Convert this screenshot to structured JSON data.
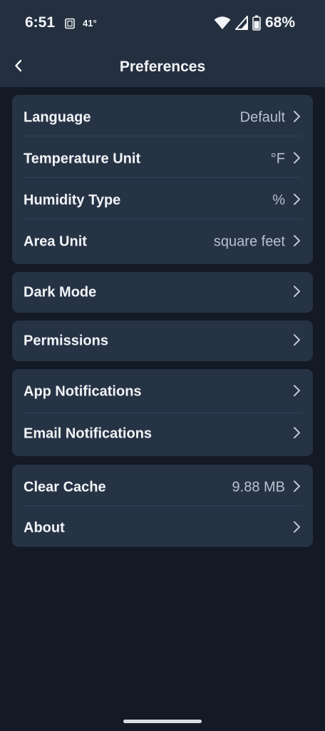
{
  "status_bar": {
    "time": "6:51",
    "temperature": "41°",
    "battery": "68%",
    "icons": [
      "sim-card-icon",
      "wifi-icon",
      "signal-icon",
      "battery-icon"
    ]
  },
  "header": {
    "title": "Preferences",
    "back_icon": "chevron-left-icon"
  },
  "sections": {
    "units": {
      "language": {
        "label": "Language",
        "value": "Default"
      },
      "temperature_unit": {
        "label": "Temperature Unit",
        "value": "°F"
      },
      "humidity_type": {
        "label": "Humidity Type",
        "value": "%"
      },
      "area_unit": {
        "label": "Area Unit",
        "value": "square feet"
      }
    },
    "appearance": {
      "dark_mode": {
        "label": "Dark Mode"
      }
    },
    "access": {
      "permissions": {
        "label": "Permissions"
      }
    },
    "notifications": {
      "app": {
        "label": "App Notifications"
      },
      "email": {
        "label": "Email Notifications"
      }
    },
    "misc": {
      "clear_cache": {
        "label": "Clear Cache",
        "value": "9.88 MB"
      },
      "about": {
        "label": "About"
      }
    }
  },
  "colors": {
    "background": "#131a26",
    "bar": "#243040",
    "card": "#263345",
    "text": "#f2f4f7",
    "secondary_text": "#b9c1cc"
  }
}
